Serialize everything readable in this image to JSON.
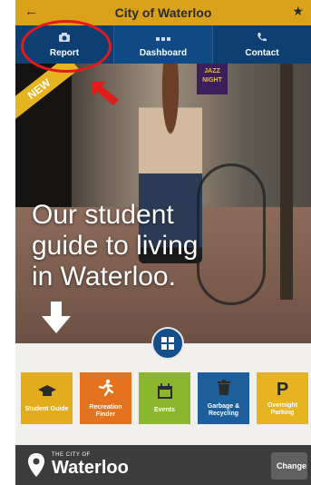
{
  "header": {
    "title": "City of Waterloo"
  },
  "nav": {
    "items": [
      {
        "label": "Report",
        "icon": "camera-icon"
      },
      {
        "label": "Dashboard",
        "icon": "dashboard-icon"
      },
      {
        "label": "Contact",
        "icon": "phone-icon"
      }
    ]
  },
  "hero": {
    "badge": "NEW",
    "sign_text": "JAZZ NIGHT",
    "headline": "Our student guide to living in Waterloo."
  },
  "tiles": [
    {
      "label": "Student Guide",
      "icon": "graduation-cap-icon",
      "color": "#e2ac1d"
    },
    {
      "label": "Recreation Finder",
      "icon": "runner-icon",
      "color": "#e3731f"
    },
    {
      "label": "Events",
      "icon": "calendar-icon",
      "color": "#8bb72e"
    },
    {
      "label": "Garbage & Recycling",
      "icon": "trash-icon",
      "color": "#1d5e9c"
    },
    {
      "label": "Overnight Parking",
      "icon": "parking-icon",
      "color": "#e5b420"
    }
  ],
  "footer": {
    "city_small": "THE CITY OF",
    "brand": "Waterloo",
    "change_label": "Change"
  },
  "colors": {
    "nav_bg": "#0d3f72",
    "accent": "#d9a21a",
    "annotation": "#e21b1b"
  }
}
